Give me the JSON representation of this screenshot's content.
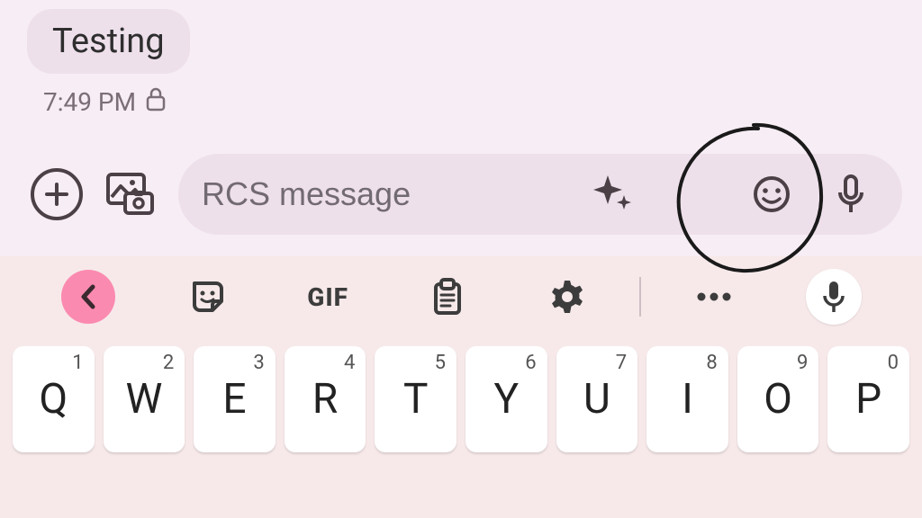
{
  "message": {
    "text": "Testing",
    "time": "7:49 PM"
  },
  "compose": {
    "placeholder": "RCS message"
  },
  "keyboard": {
    "gif_label": "GIF",
    "row1": [
      {
        "letter": "Q",
        "sup": "1"
      },
      {
        "letter": "W",
        "sup": "2"
      },
      {
        "letter": "E",
        "sup": "3"
      },
      {
        "letter": "R",
        "sup": "4"
      },
      {
        "letter": "T",
        "sup": "5"
      },
      {
        "letter": "Y",
        "sup": "6"
      },
      {
        "letter": "U",
        "sup": "7"
      },
      {
        "letter": "I",
        "sup": "8"
      },
      {
        "letter": "O",
        "sup": "9"
      },
      {
        "letter": "P",
        "sup": "0"
      }
    ]
  }
}
